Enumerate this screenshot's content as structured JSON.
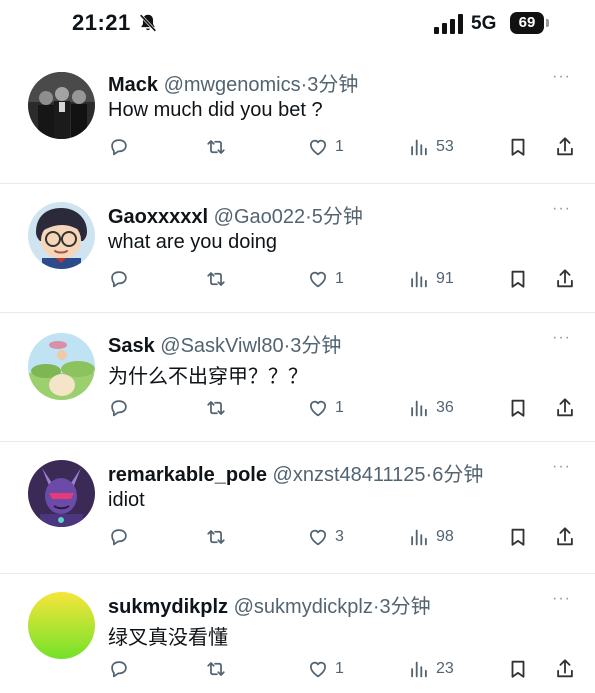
{
  "status_bar": {
    "time": "21:21",
    "network": "5G",
    "battery": "69",
    "icons": [
      "bell-slash-icon",
      "signal-bars-icon",
      "battery-icon"
    ]
  },
  "colors": {
    "text_primary": "#0f1419",
    "text_secondary": "#536471",
    "divider": "#e7e9ea"
  },
  "tweets": [
    {
      "name": "Mack",
      "handle": "@mwgenomics",
      "separator": "·",
      "time": "3分钟",
      "text": "How much did you bet ?",
      "replies": "",
      "retweets": "",
      "likes": "1",
      "views": "53",
      "more": "···"
    },
    {
      "name": "Gaoxxxxxl",
      "handle": "@Gao022",
      "separator": "·",
      "time": "5分钟",
      "text": "what are you doing",
      "replies": "",
      "retweets": "",
      "likes": "1",
      "views": "91",
      "more": "···"
    },
    {
      "name": "Sask",
      "handle": "@SaskViwl80",
      "separator": "·",
      "time": "3分钟",
      "text": "为什么不出穿甲？？？",
      "replies": "",
      "retweets": "",
      "likes": "1",
      "views": "36",
      "more": "···"
    },
    {
      "name": "remarkable_pole",
      "handle": "@xnzst48411125",
      "separator": "·",
      "time": "6分钟",
      "text": "idiot",
      "replies": "",
      "retweets": "",
      "likes": "3",
      "views": "98",
      "more": "···"
    },
    {
      "name": "sukmydikplz",
      "handle": "@sukmydickplz",
      "separator": "·",
      "time": "3分钟",
      "text": "绿叉真没看懂",
      "replies": "",
      "retweets": "",
      "likes": "1",
      "views": "23",
      "more": "···"
    }
  ]
}
